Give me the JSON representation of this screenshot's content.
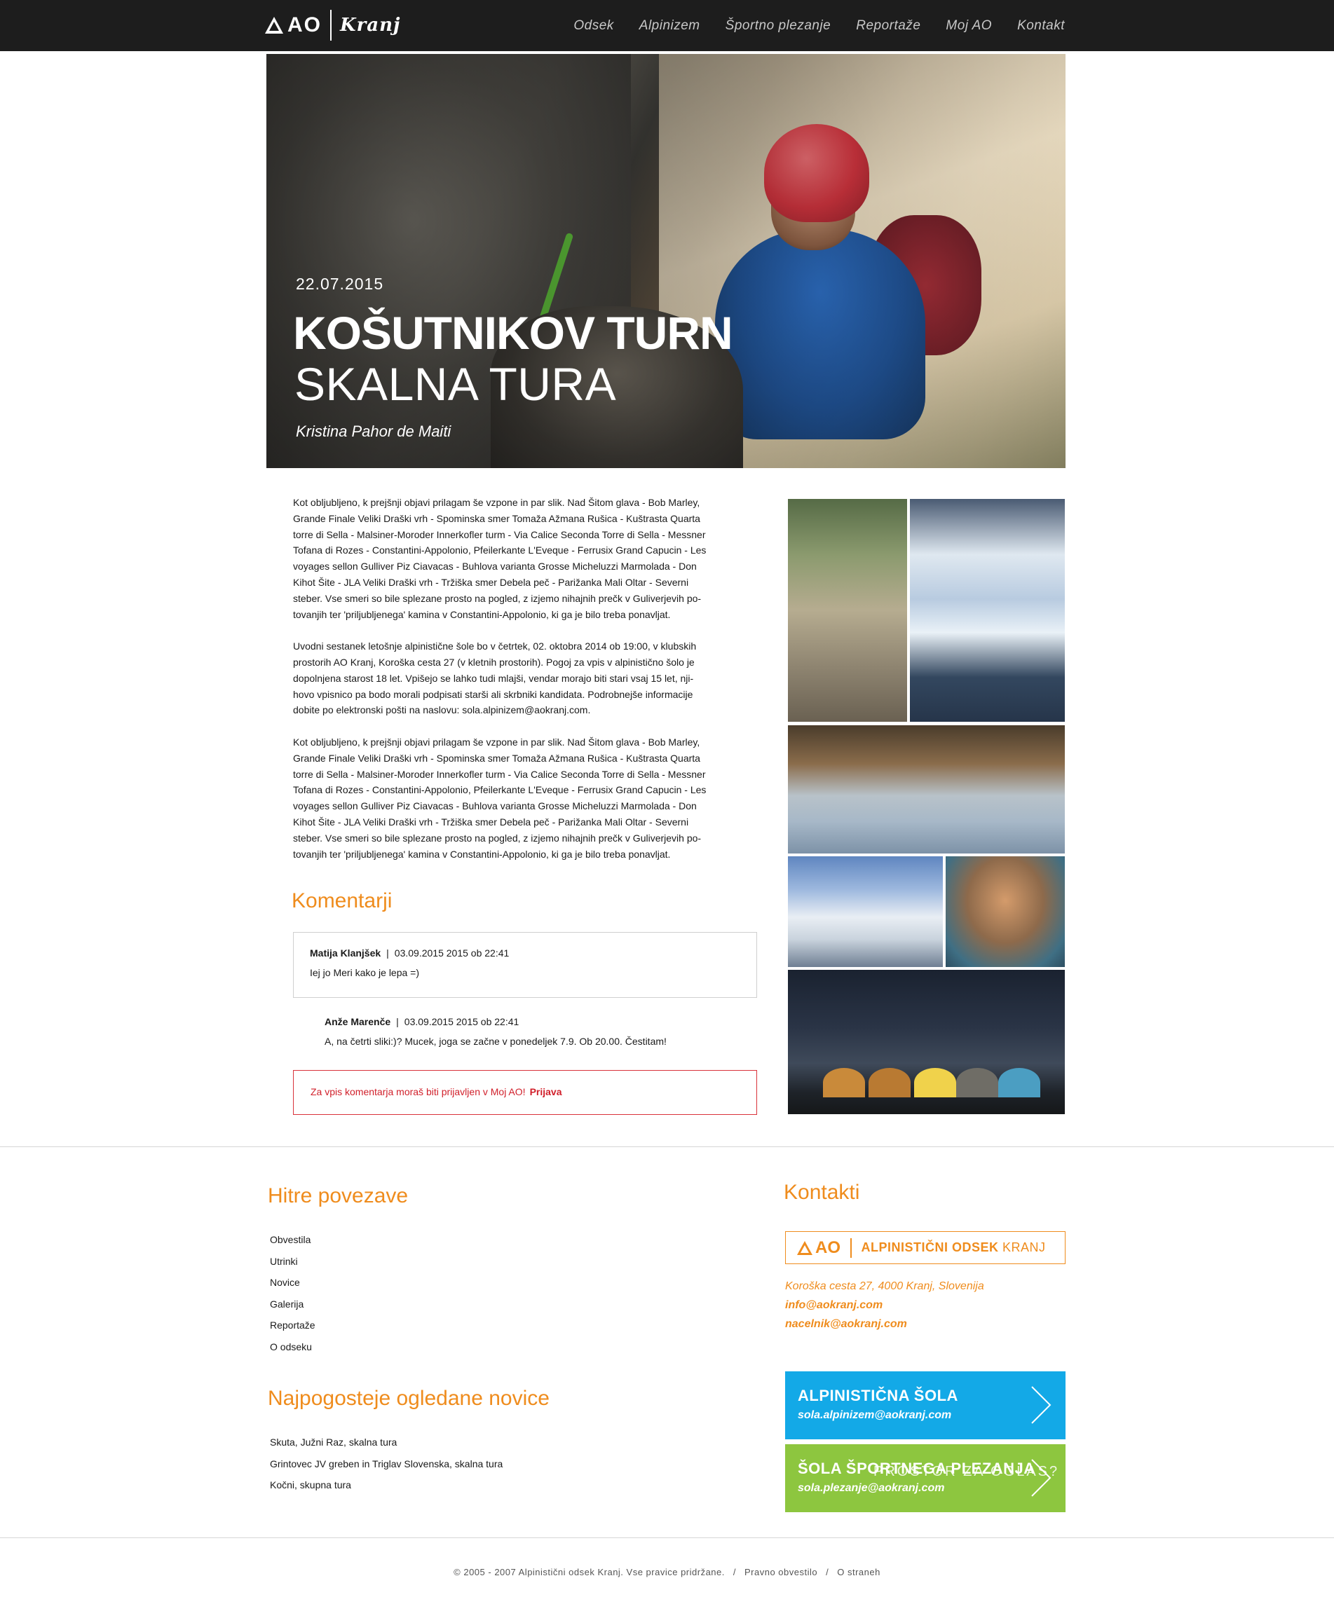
{
  "header": {
    "logo_ao": "AO",
    "logo_kranj": "Kranj",
    "nav": [
      "Odsek",
      "Alpinizem",
      "Športno plezanje",
      "Reportaže",
      "Moj AO",
      "Kontakt"
    ]
  },
  "hero": {
    "date": "22.07.2015",
    "title": "KOŠUTNIKOV TURN",
    "subtitle": "SKALNA TURA",
    "author": "Kristina Pahor de Maiti"
  },
  "article": {
    "paragraphs": [
      "Kot obljubljeno, k prejšnji objavi prilagam še vzpone in par slik. Nad Šitom glava - Bob Marley,\nGrande Finale Veliki Draški vrh - Spominska smer Tomaža Ažmana Rušica - Kuštrasta Quarta\ntorre di Sella - Malsiner-Moroder Innerkofler turm - Via Calice Seconda Torre di Sella - Messner\nTofana di Rozes - Constantini-Appolonio, Pfeilerkante L'Eveque - Ferrusix Grand Capucin - Les\nvoyages sellon Gulliver Piz Ciavacas - Buhlova varianta Grosse Micheluzzi Marmolada - Don\nKihot Šite - JLA Veliki Draški vrh - Tržiška smer Debela peč - Parižanka Mali Oltar - Severni\nsteber. Vse smeri so bile splezane prosto na pogled, z izjemo nihajnih prečk v Guliverjevih po-\ntovanjih ter 'priljubljenega' kamina v Constantini-Appolonio, ki ga je bilo treba ponavljat.",
      "Uvodni sestanek letošnje alpinistične šole bo v četrtek, 02. oktobra 2014 ob 19:00, v klubskih\nprostorih AO Kranj, Koroška cesta 27 (v kletnih prostorih). Pogoj za vpis v alpinistično šolo je\ndopolnjena starost 18 let. Vpišejo se lahko tudi mlajši, vendar morajo biti stari vsaj 15 let, nji-\nhovo vpisnico pa bodo morali podpisati starši ali skrbniki kandidata. Podrobnejše informacije\ndobite po elektronski pošti na naslovu: sola.alpinizem@aokranj.com.",
      "Kot obljubljeno, k prejšnji objavi prilagam še vzpone in par slik. Nad Šitom glava - Bob Marley,\nGrande Finale Veliki Draški vrh - Spominska smer Tomaža Ažmana Rušica - Kuštrasta Quarta\ntorre di Sella - Malsiner-Moroder Innerkofler turm - Via Calice Seconda Torre di Sella - Messner\nTofana di Rozes - Constantini-Appolonio, Pfeilerkante L'Eveque - Ferrusix Grand Capucin - Les\nvoyages sellon Gulliver Piz Ciavacas - Buhlova varianta Grosse Micheluzzi Marmolada - Don\nKihot Šite - JLA Veliki Draški vrh - Tržiška smer Debela peč - Parižanka Mali Oltar - Severni\nsteber. Vse smeri so bile splezane prosto na pogled, z izjemo nihajnih prečk v Guliverjevih po-\ntovanjih ter 'priljubljenega' kamina v Constantini-Appolonio, ki ga je bilo treba ponavljat."
    ]
  },
  "comments": {
    "title": "Komentarji",
    "items": [
      {
        "author": "Matija Klanjšek",
        "date": "03.09.2015 2015 ob 22:41",
        "text": "Iej jo Meri kako je lepa =)"
      },
      {
        "author": "Anže Marenče",
        "date": "03.09.2015 2015 ob 22:41",
        "text": "A, na četrti sliki:)? Mucek, joga se začne v ponedeljek 7.9. Ob 20.00. Čestitam!"
      }
    ],
    "login_notice": "Za vpis komentarja moraš biti prijavljen v Moj AO!",
    "login_link": "Prijava"
  },
  "footer": {
    "quick_links_title": "Hitre povezave",
    "quick_links": [
      "Obvestila",
      "Utrinki",
      "Novice",
      "Galerija",
      "Reportaže",
      "O odseku"
    ],
    "popular_title": "Najpogosteje ogledane novice",
    "popular": [
      "Skuta, Južni Raz, skalna tura",
      "Grintovec JV greben in Triglav Slovenska, skalna tura",
      "Kočni, skupna tura"
    ],
    "contacts_title": "Kontakti",
    "contact_logo_ao": "AO",
    "contact_logo_name_bold": "ALPINISTIČNI ODSEK",
    "contact_logo_name_light": "KRANJ",
    "address": "Koroška cesta 27, 4000 Kranj, Slovenija",
    "email1": "info@aokranj.com",
    "email2": "nacelnik@aokranj.com",
    "cta1_title": "ALPINISTIČNA ŠOLA",
    "cta1_email": "sola.alpinizem@aokranj.com",
    "cta2_title": "ŠOLA ŠPORTNEGA PLEZANJA",
    "cta2_ghost": "PROSTOR ZA OGLAS?",
    "cta2_email": "sola.plezanje@aokranj.com",
    "copyright": "© 2005 - 2007 Alpinistični odsek Kranj. Vse pravice pridržane.",
    "legal": "Pravno obvestilo",
    "about": "O straneh"
  },
  "colors": {
    "accent": "#ef8c1d",
    "topbar": "#1d1d1d",
    "cta_blue": "#13a9e7",
    "cta_green": "#8dc63f",
    "error": "#d9323a"
  }
}
